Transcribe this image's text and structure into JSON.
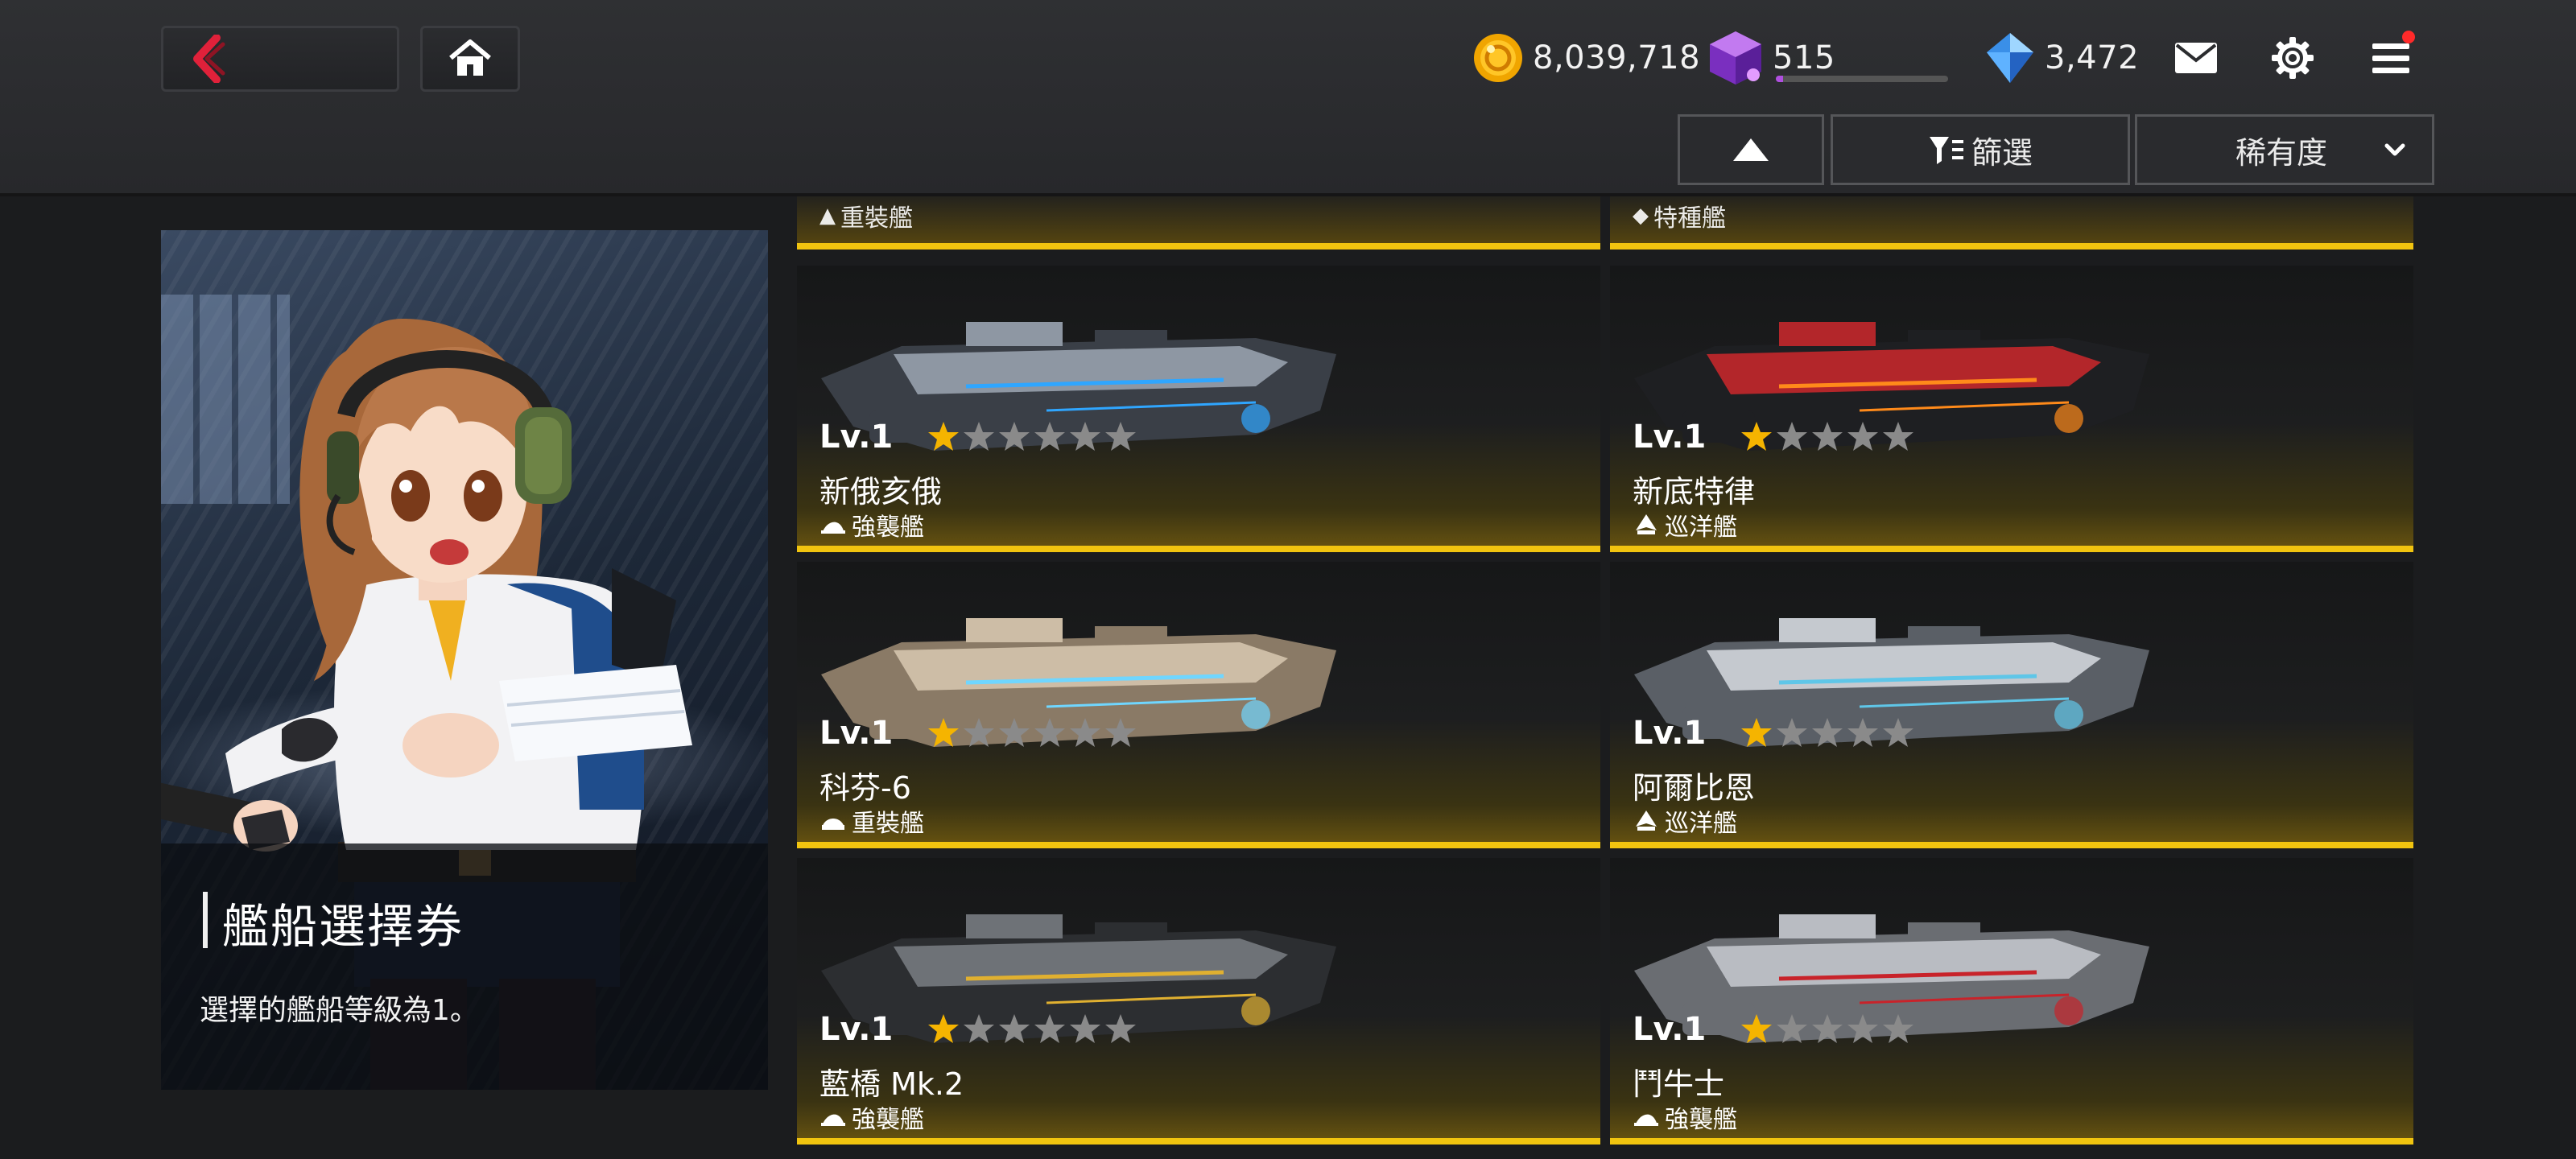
{
  "resources": {
    "gold": "8,039,718",
    "energy": "515",
    "energy_fill": 0.04,
    "gems": "3,472"
  },
  "controls": {
    "sort_direction": "ascending",
    "filter_label": "篩選",
    "sort_label": "稀有度"
  },
  "notification_dot": true,
  "panel": {
    "title": "艦船選擇券",
    "description": "選擇的艦船等級為1。"
  },
  "partial_row": [
    {
      "class": "重裝艦"
    },
    {
      "class": "特種艦"
    }
  ],
  "ships": [
    {
      "level": "Lv.1",
      "stars": 1,
      "max_stars": 6,
      "name": "新俄亥俄",
      "class": "強襲艦",
      "class_icon": "assault-class-icon",
      "palette": "steel-blue"
    },
    {
      "level": "Lv.1",
      "stars": 1,
      "max_stars": 5,
      "name": "新底特律",
      "class": "巡洋艦",
      "class_icon": "cruiser-class-icon",
      "palette": "red-black"
    },
    {
      "level": "Lv.1",
      "stars": 1,
      "max_stars": 6,
      "name": "科芬-6",
      "class": "重裝艦",
      "class_icon": "heavy-class-icon",
      "palette": "tan"
    },
    {
      "level": "Lv.1",
      "stars": 1,
      "max_stars": 5,
      "name": "阿爾比恩",
      "class": "巡洋艦",
      "class_icon": "cruiser-class-icon",
      "palette": "gray-white"
    },
    {
      "level": "Lv.1",
      "stars": 1,
      "max_stars": 6,
      "name": "藍橋 Mk.2",
      "class": "強襲艦",
      "class_icon": "assault-class-icon",
      "palette": "dark-gray"
    },
    {
      "level": "Lv.1",
      "stars": 1,
      "max_stars": 5,
      "name": "鬥牛士",
      "class": "強襲艦",
      "class_icon": "assault-class-icon",
      "palette": "red-silver"
    }
  ],
  "colors": {
    "accent_gold": "#f1c40f",
    "back_arrow": "#e0213a",
    "star_filled": "#f5b400",
    "star_empty": "#8a8a8a"
  }
}
